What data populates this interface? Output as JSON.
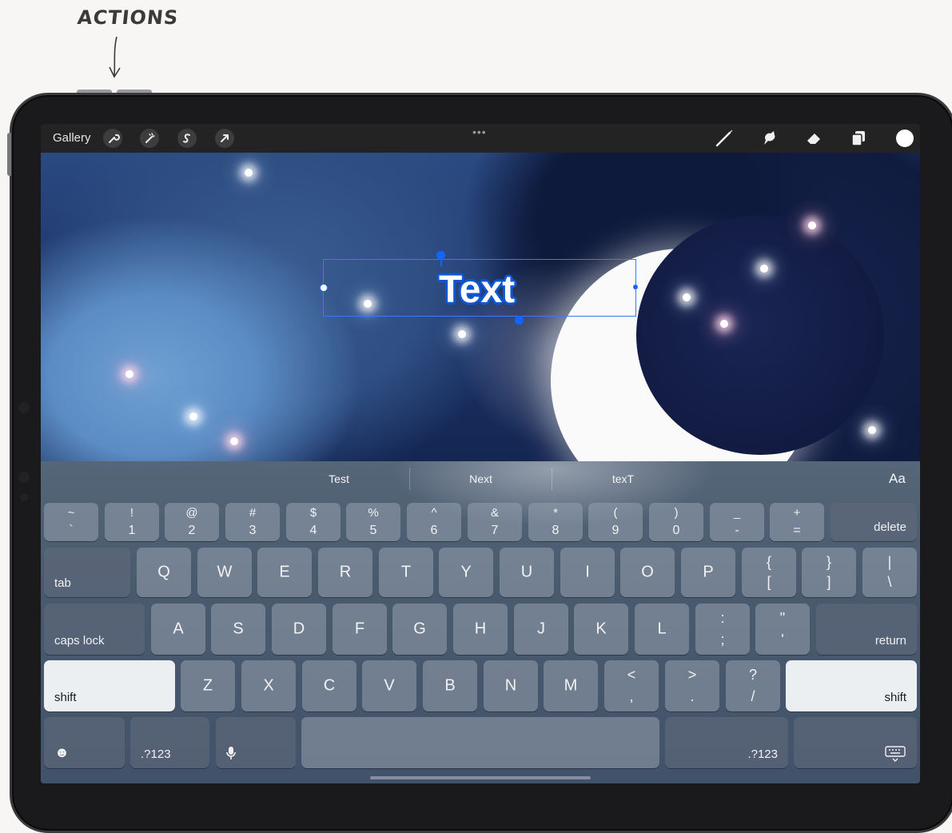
{
  "annotation": {
    "label": "ACTIONS"
  },
  "toolbar": {
    "gallery_label": "Gallery",
    "left_icons": [
      "wrench-icon",
      "magic-wand-icon",
      "selection-s-icon",
      "transform-arrow-icon"
    ],
    "right_tools": [
      "brush-icon",
      "smudge-icon",
      "eraser-icon",
      "layers-icon"
    ],
    "more": "•••",
    "current_color": "#ffffff"
  },
  "canvas": {
    "text_object": "Text"
  },
  "keyboard": {
    "suggestions": [
      "Test",
      "Next",
      "texT"
    ],
    "format_button": "Aa",
    "row1": [
      {
        "up": "~",
        "dn": "`"
      },
      {
        "up": "!",
        "dn": "1"
      },
      {
        "up": "@",
        "dn": "2"
      },
      {
        "up": "#",
        "dn": "3"
      },
      {
        "up": "$",
        "dn": "4"
      },
      {
        "up": "%",
        "dn": "5"
      },
      {
        "up": "^",
        "dn": "6"
      },
      {
        "up": "&",
        "dn": "7"
      },
      {
        "up": "*",
        "dn": "8"
      },
      {
        "up": "(",
        "dn": "9"
      },
      {
        "up": ")",
        "dn": "0"
      },
      {
        "up": "_",
        "dn": "-"
      },
      {
        "up": "+",
        "dn": "="
      }
    ],
    "delete": "delete",
    "tab": "tab",
    "row2": [
      "Q",
      "W",
      "E",
      "R",
      "T",
      "Y",
      "U",
      "I",
      "O",
      "P"
    ],
    "row2_sym": [
      {
        "up": "{",
        "dn": "["
      },
      {
        "up": "}",
        "dn": "]"
      },
      {
        "up": "|",
        "dn": "\\"
      }
    ],
    "caps_lock": "caps lock",
    "row3": [
      "A",
      "S",
      "D",
      "F",
      "G",
      "H",
      "J",
      "K",
      "L"
    ],
    "row3_sym": [
      {
        "up": ":",
        "dn": ";"
      },
      {
        "up": "\"",
        "dn": "'"
      }
    ],
    "return": "return",
    "shift": "shift",
    "row4": [
      "Z",
      "X",
      "C",
      "V",
      "B",
      "N",
      "M"
    ],
    "row4_sym": [
      {
        "up": "<",
        "dn": ","
      },
      {
        "up": ">",
        "dn": "."
      },
      {
        "up": "?",
        "dn": "/"
      }
    ],
    "emoji": "☻",
    "numbers": ".?123",
    "dictation": "🎙",
    "dismiss": "⌨"
  }
}
